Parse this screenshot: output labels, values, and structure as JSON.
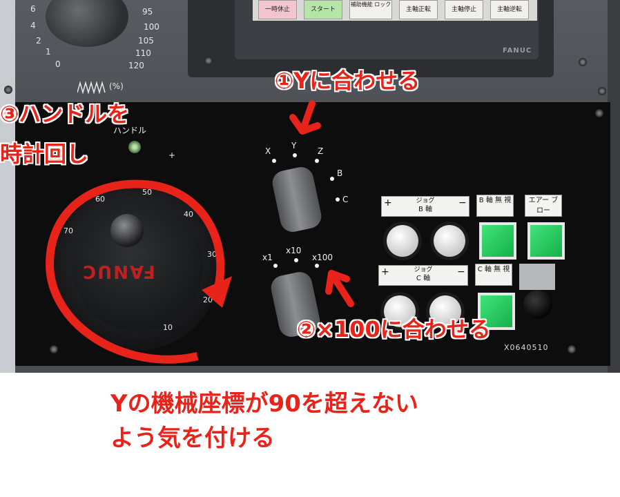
{
  "panel_top": {
    "lcd_keys": [
      "一時休止",
      "スタート",
      "補助機能 ロック",
      "主軸正転",
      "主軸停止",
      "主軸逆転"
    ],
    "brand_small": "FANUC",
    "override_scale_left": [
      "6",
      "4",
      "2",
      "1",
      "0"
    ],
    "override_scale_right": [
      "95",
      "100",
      "105",
      "110",
      "120"
    ],
    "override_unit": "(%)"
  },
  "handle": {
    "label": "ハンドル",
    "plus": "+",
    "logo": "FANUC",
    "scale": [
      "60",
      "50",
      "40",
      "70",
      "30",
      "20",
      "10"
    ]
  },
  "axis_switch": {
    "positions": [
      "X",
      "Y",
      "Z",
      "B",
      "C"
    ]
  },
  "step_switch": {
    "positions": [
      "x1",
      "x10",
      "x100"
    ]
  },
  "buttons": {
    "jog_b_label": "ジョグ",
    "jog_b_axis": "B 軸",
    "jog_c_label": "ジョグ",
    "jog_c_axis": "C 軸",
    "plus": "+",
    "minus": "−",
    "b_axis_ignore": "B 軸 無 視",
    "air_blow": "エアー ブロー",
    "c_axis_ignore": "C 軸 無 視"
  },
  "plate_code": "X0640510",
  "annotations": {
    "step1": "①Yに合わせる",
    "step2": "②×100に合わせる",
    "step3_line1": "③ハンドルを",
    "step3_line2": "時計回し",
    "note_line1": "Yの機械座標が90を超えない",
    "note_line2": "よう気を付ける"
  },
  "colors": {
    "annotation_red": "#e8231a",
    "panel_black": "#0d0d0e",
    "button_green": "#22c75a"
  }
}
